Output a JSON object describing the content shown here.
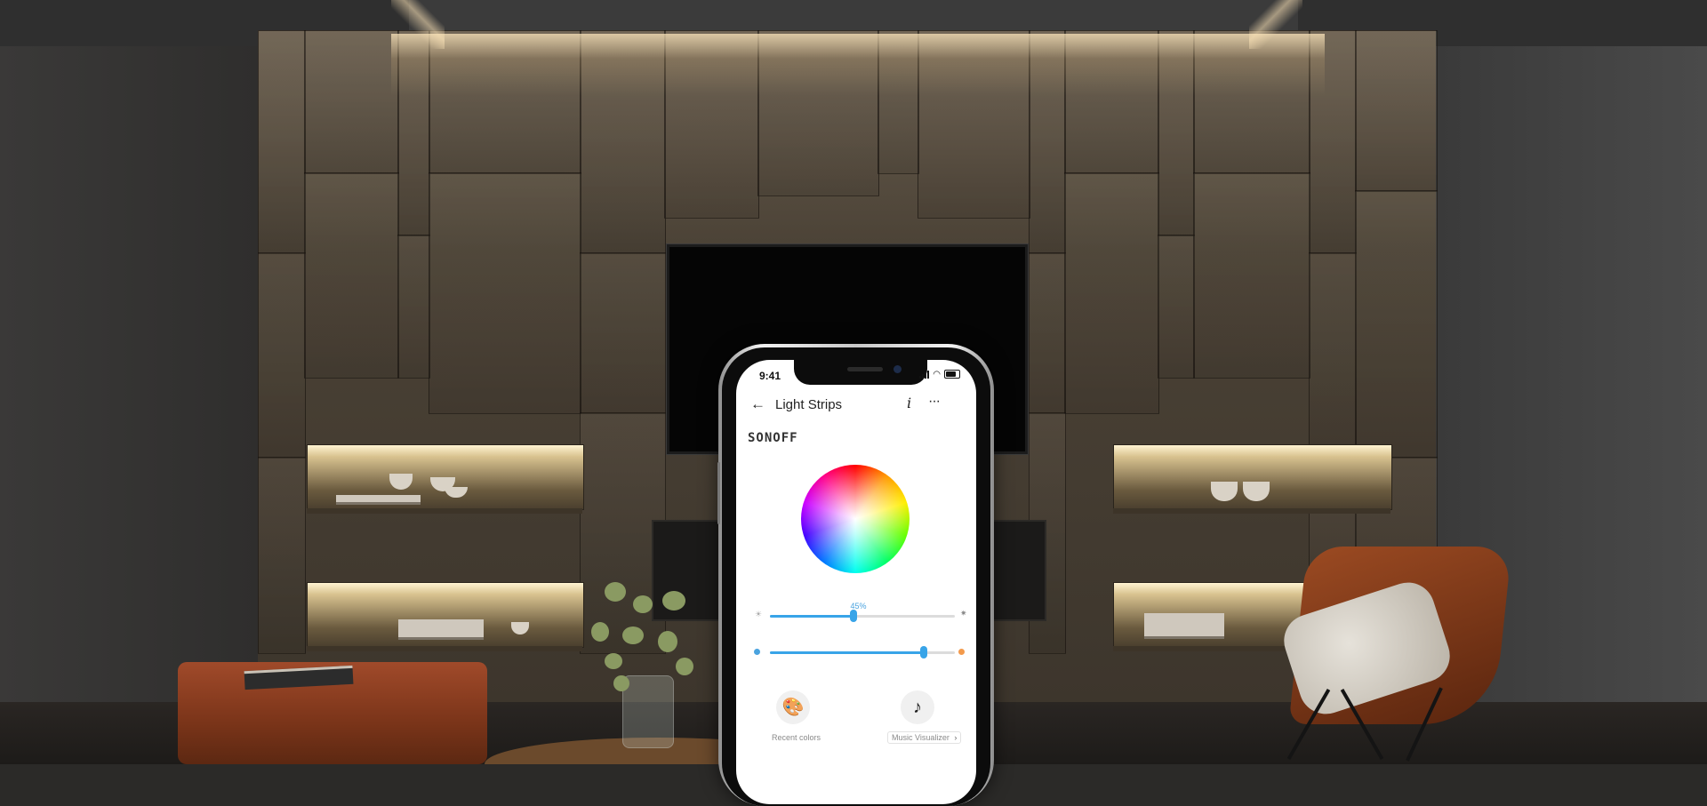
{
  "status_bar": {
    "time": "9:41"
  },
  "header": {
    "title": "Light Strips",
    "back_icon": "back-arrow-icon",
    "info_label": "i",
    "more_label": "···"
  },
  "brand": {
    "logo_text": "SONOFF"
  },
  "brightness": {
    "label": "45%",
    "value": 0.45
  },
  "color_temperature": {
    "value": 0.83,
    "cool_color": "#4aa3df",
    "warm_color": "#f39a4c"
  },
  "actions": {
    "recent_colors": {
      "label": "Recent colors",
      "icon": "palette-icon"
    },
    "music_visualizer": {
      "label": "Music Visualizer",
      "icon": "music-note-icon",
      "chevron": "›"
    }
  },
  "colors": {
    "accent": "#38a4e8"
  }
}
